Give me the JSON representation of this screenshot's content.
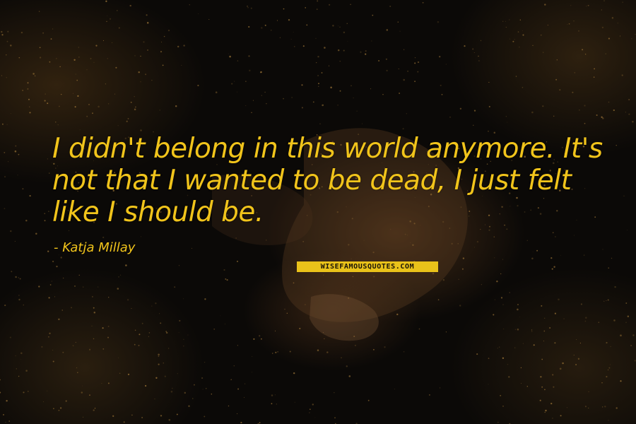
{
  "quote": {
    "line1": "I didn't belong in this world anymore. It's",
    "line2": "not that I wanted to be dead, I just felt",
    "line3": "like I should be.",
    "author": "- Katja Millay"
  },
  "watermark": {
    "label": "WISEFAMOUSQUOTES.COM"
  },
  "colors": {
    "quote_text": "#f1c41b",
    "background": "#0b0907",
    "watermark_background": "#e9c21a"
  }
}
